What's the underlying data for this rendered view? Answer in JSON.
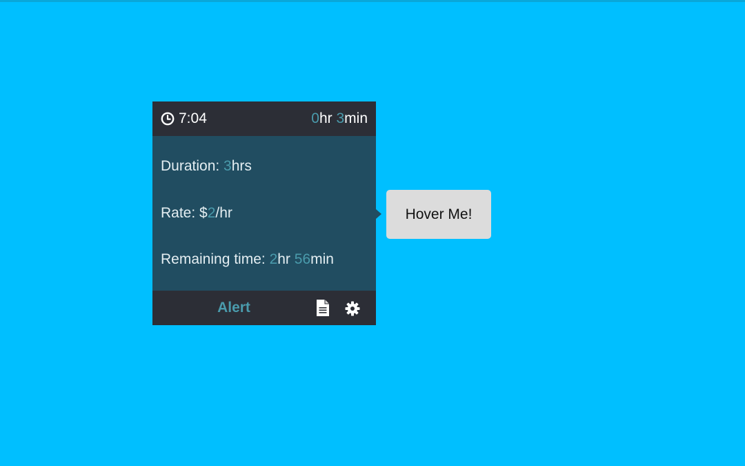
{
  "theme": {
    "page_background": "#00bfff",
    "widget_body": "#214d61",
    "widget_bar": "#2c2e36",
    "accent": "#4a9bac",
    "hover_box": "#dcdcdc"
  },
  "header": {
    "clock_icon": "clock-icon",
    "time": "7:04",
    "elapsed": {
      "hours_value": "0",
      "hours_unit": "hr",
      "minutes_value": "3",
      "minutes_unit": "min"
    }
  },
  "details": {
    "duration": {
      "label": "Duration: ",
      "value": "3",
      "unit": "hrs"
    },
    "rate": {
      "label": "Rate: ",
      "prefix": "$",
      "value": "2",
      "unit": "/hr"
    },
    "remaining": {
      "label": "Remaining time: ",
      "hours_value": "2",
      "hours_unit": "hr",
      "minutes_value": "56",
      "minutes_unit": "min"
    }
  },
  "footer": {
    "alert_label": "Alert",
    "document_icon": "document-icon",
    "settings_icon": "gear-icon"
  },
  "hover_box": {
    "label": "Hover Me!"
  }
}
